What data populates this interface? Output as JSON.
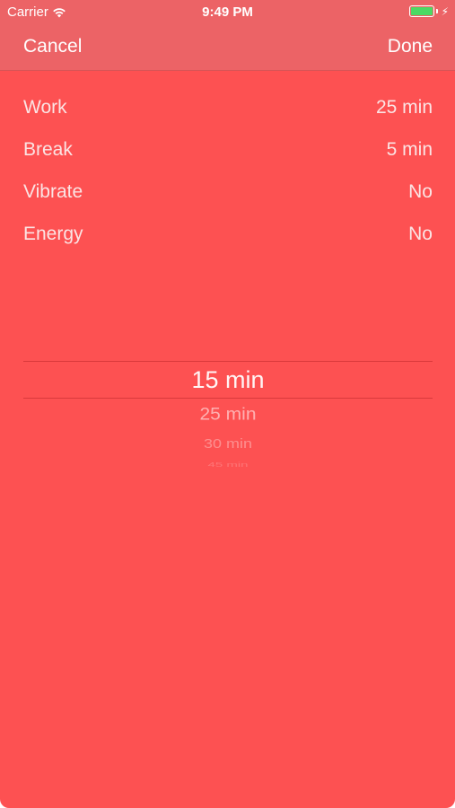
{
  "status_bar": {
    "carrier": "Carrier",
    "time": "9:49 PM",
    "battery_color": "#4cd964",
    "icons": [
      "wifi-icon",
      "battery-icon",
      "charging-bolt-icon"
    ]
  },
  "nav": {
    "cancel_label": "Cancel",
    "done_label": "Done"
  },
  "settings": [
    {
      "label": "Work",
      "value": "25 min"
    },
    {
      "label": "Break",
      "value": "5 min"
    },
    {
      "label": "Vibrate",
      "value": "No"
    },
    {
      "label": "Energy",
      "value": "No"
    }
  ],
  "picker": {
    "selected": "15 min",
    "options_below": [
      "25 min",
      "30 min",
      "45 min"
    ]
  },
  "colors": {
    "background": "#fd5152",
    "top_bar": "#ec6366",
    "text": "#ffffff"
  }
}
